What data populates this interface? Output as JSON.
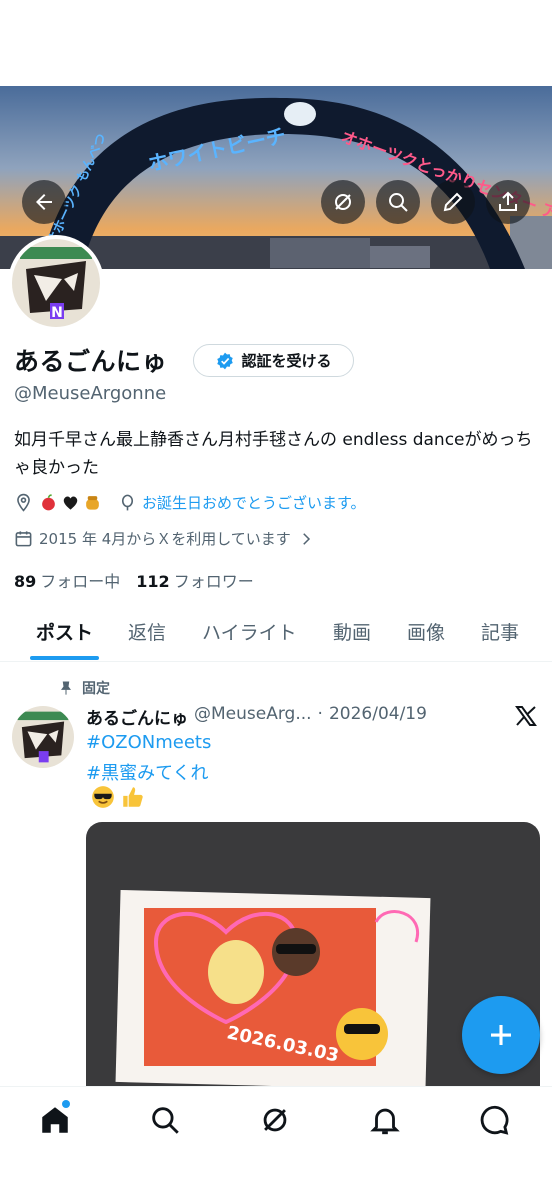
{
  "profile": {
    "display_name": "あるごんにゅ",
    "verify_label": "認証を受ける",
    "handle": "@MeuseArgonne",
    "bio": "如月千早さん最上静香さん月村手毬さんの endless danceがめっちゃ良かった",
    "birthday_text": "お誕生日おめでとうございます。",
    "joined_text": "2015 年 4月からＸを利用しています",
    "following_count": "89",
    "following_label": "フォロー中",
    "followers_count": "112",
    "followers_label": "フォロワー",
    "location_emojis": [
      "red-apple",
      "black-heart",
      "honey-pot"
    ]
  },
  "banner": {
    "arch_text_left": "オホーツク もんべつ",
    "arch_text_top": "ホワイトビーチ",
    "arch_text_right": "オホーツクとっかりセンター アザラシランド"
  },
  "header_buttons": [
    "back-icon",
    "grok-icon",
    "search-icon",
    "compose-icon",
    "share-icon"
  ],
  "tabs": [
    {
      "label": "ポスト",
      "active": true
    },
    {
      "label": "返信",
      "active": false
    },
    {
      "label": "ハイライト",
      "active": false
    },
    {
      "label": "動画",
      "active": false
    },
    {
      "label": "画像",
      "active": false
    },
    {
      "label": "記事",
      "active": false
    }
  ],
  "post": {
    "pinned_label": "固定",
    "author_name": "あるごんにゅ",
    "author_handle": "@MeuseArg...",
    "date": "2026/04/19",
    "hashtags": [
      "#OZONmeets",
      "#黒蜜みてくれ"
    ],
    "emojis": [
      "smiling-face-with-sunglasses",
      "thumbs-up"
    ],
    "media_text": "2026.03.03"
  },
  "bottom_nav": [
    "home-icon",
    "search-icon",
    "grok-icon",
    "notifications-icon",
    "messages-icon"
  ],
  "colors": {
    "accent": "#1d9bf0",
    "text": "#0f1419",
    "secondary_text": "#536471",
    "border": "#cfd9de"
  }
}
